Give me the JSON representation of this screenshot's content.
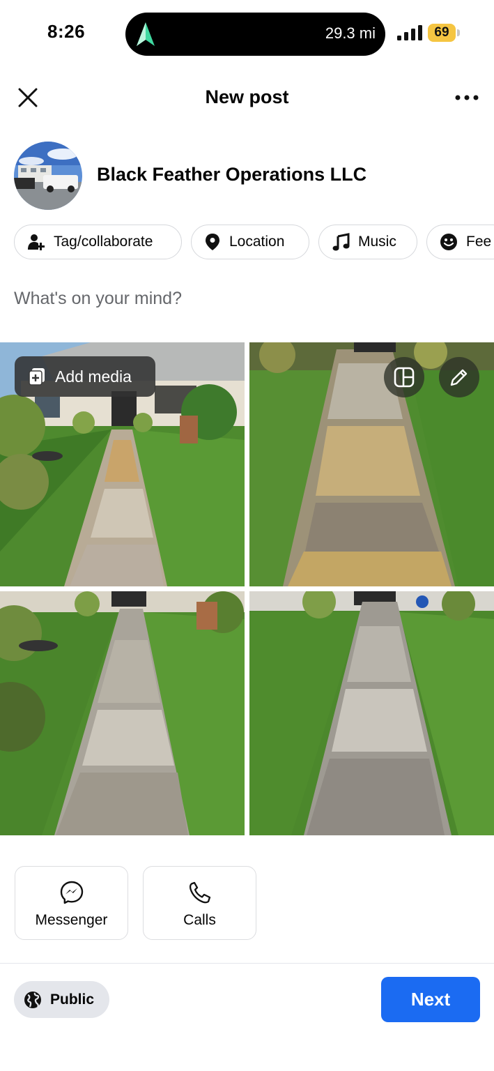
{
  "status_bar": {
    "time": "8:26",
    "navigation_distance": "29.3 mi",
    "battery_level": "69",
    "icons": [
      "navigation-arrow-icon",
      "cellular-signal-icon",
      "battery-icon"
    ]
  },
  "header": {
    "title": "New post",
    "close_icon": "close-icon",
    "more_icon": "more-icon"
  },
  "profile": {
    "name": "Black Feather Operations LLC"
  },
  "chips": [
    {
      "label": "Tag/collaborate",
      "icon": "tag-person-icon"
    },
    {
      "label": "Location",
      "icon": "location-pin-icon"
    },
    {
      "label": "Music",
      "icon": "music-note-icon"
    },
    {
      "label": "Fee",
      "icon": "feeling-icon"
    }
  ],
  "composer": {
    "placeholder": "What's on your mind?"
  },
  "media": {
    "add_media_label": "Add media",
    "photo_count": 4,
    "layout_icon": "layout-icon",
    "edit_icon": "edit-pencil-icon"
  },
  "contact_options": [
    {
      "label": "Messenger",
      "icon": "messenger-icon"
    },
    {
      "label": "Calls",
      "icon": "phone-icon"
    }
  ],
  "footer": {
    "audience_label": "Public",
    "next_label": "Next"
  },
  "colors": {
    "accent": "#1b6bf2",
    "chip_border": "#d6d8dc",
    "placeholder_text": "#65676b",
    "battery": "#f5c542"
  }
}
